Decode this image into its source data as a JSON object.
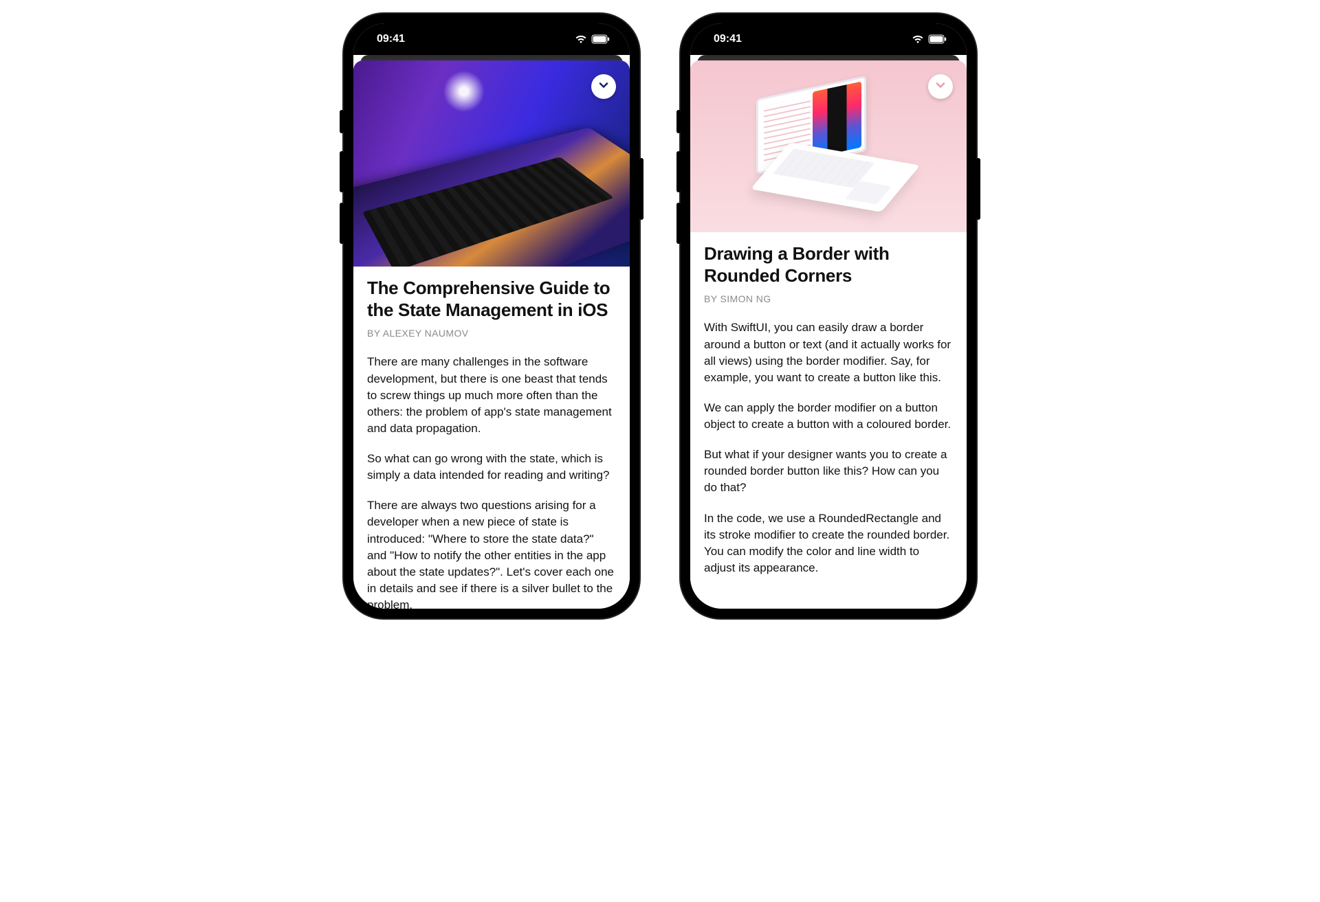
{
  "status": {
    "time": "09:41"
  },
  "phones": [
    {
      "close_icon_color": "#13216a",
      "article": {
        "title": "The Comprehensive Guide to the State Management in iOS",
        "byline": "BY ALEXEY NAUMOV",
        "paragraphs": [
          "There are many challenges in the software development, but there is one beast that tends to screw things up much more often than the others: the problem of app's state management and data propagation.",
          "So what can go wrong with the state, which is simply a data intended for reading and writing?",
          "There are always two questions arising for a developer when a new piece of state is introduced: \"Where to store the state data?\" and \"How to notify the other entities in the app about the state updates?\". Let's cover each one in details and see if there is a silver bullet to the problem."
        ]
      }
    },
    {
      "close_icon_color": "#e89ab0",
      "article": {
        "title": "Drawing a Border with Rounded Corners",
        "byline": "BY SIMON NG",
        "paragraphs": [
          "With SwiftUI, you can easily draw a border around a button or text (and it actually works for all views) using the border modifier. Say, for example, you want to create a button like this.",
          "We can apply the border modifier on a button object to create a button with a coloured border.",
          "But what if your designer wants you to create a rounded border button like this? How can you do that?",
          "In the code, we use a RoundedRectangle and its stroke modifier to create the rounded border. You can modify the color and line width to adjust its appearance."
        ]
      }
    }
  ]
}
